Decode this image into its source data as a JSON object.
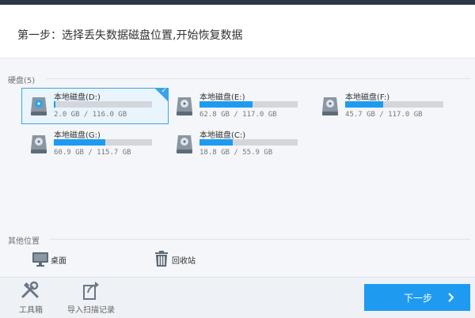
{
  "header": {
    "title": "第一步：选择丢失数据磁盘位置,开始恢复数据"
  },
  "drives_section": {
    "label": "硬盘(5)",
    "drives": [
      {
        "name": "本地磁盘(D:)",
        "size": "2.0 GB / 116.0 GB",
        "used_fraction": 0.017,
        "selected": true,
        "icon": "hard-drive-icon"
      },
      {
        "name": "本地磁盘(E:)",
        "size": "62.8 GB / 117.0 GB",
        "used_fraction": 0.537,
        "selected": false,
        "icon": "hard-drive-icon"
      },
      {
        "name": "本地磁盘(F:)",
        "size": "45.7 GB / 117.0 GB",
        "used_fraction": 0.391,
        "selected": false,
        "icon": "hard-drive-icon"
      },
      {
        "name": "本地磁盘(G:)",
        "size": "60.9 GB / 115.7 GB",
        "used_fraction": 0.526,
        "selected": false,
        "icon": "hard-drive-icon"
      },
      {
        "name": "本地磁盘(C:)",
        "size": "18.8 GB / 55.9 GB",
        "used_fraction": 0.336,
        "selected": false,
        "icon": "hard-drive-icon"
      }
    ]
  },
  "other_section": {
    "label": "其他位置",
    "items": [
      {
        "label": "桌面",
        "icon": "monitor-icon"
      },
      {
        "label": "回收站",
        "icon": "trash-icon"
      }
    ]
  },
  "footer": {
    "tools": [
      {
        "label": "工具箱",
        "icon": "tools-icon"
      },
      {
        "label": "导入扫描记录",
        "icon": "import-icon"
      }
    ],
    "next_label": "下一步"
  },
  "colors": {
    "accent": "#1e9bf0",
    "selected_border": "#3aa3e6",
    "selected_bg": "#e9f4fc",
    "topbar": "#2c3748"
  }
}
